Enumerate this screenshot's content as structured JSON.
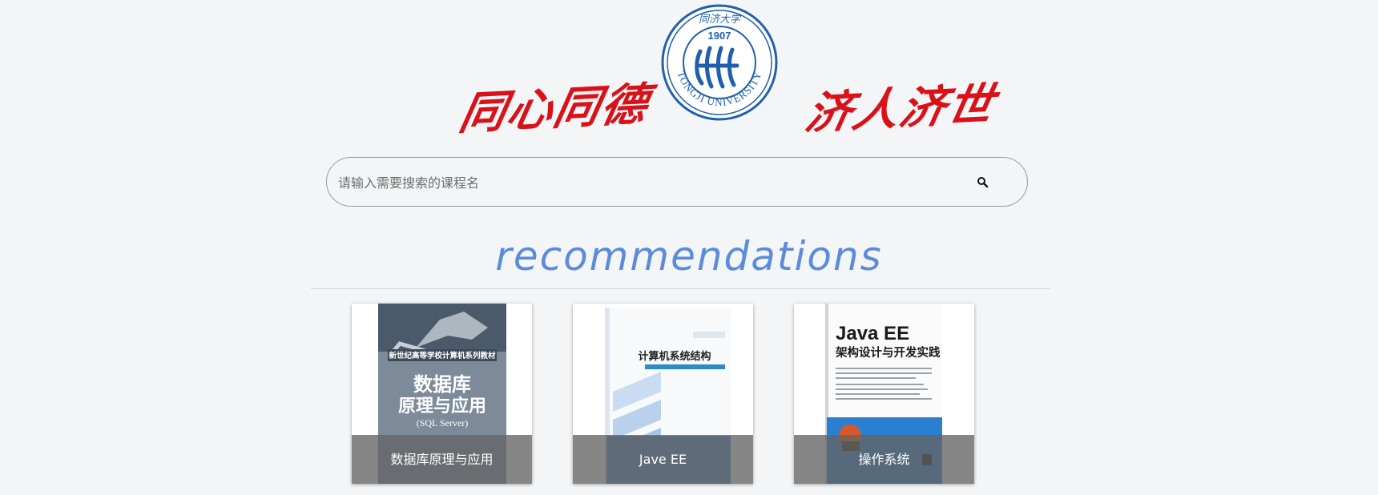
{
  "header": {
    "motto_left": "同心同德",
    "motto_right": "济人济世",
    "seal": {
      "year": "1907",
      "university": "TONGJI UNIVERSITY",
      "name_cn": "同济大学"
    }
  },
  "search": {
    "placeholder": "请输入需要搜索的课程名",
    "value": "",
    "button_icon": "search-icon"
  },
  "recommendations": {
    "title": "recommendations",
    "title_color": "#5b8cdc",
    "courses": [
      {
        "label": "数据库原理与应用",
        "cover": {
          "series": "新世纪高等学校计算机系列教材",
          "title_line1": "数据库",
          "title_line2": "原理与应用",
          "subtitle": "(SQL Server)"
        }
      },
      {
        "label": "Jave EE",
        "cover": {
          "title": "计算机系统结构"
        }
      },
      {
        "label": "操作系统",
        "cover": {
          "title_line1": "Java EE",
          "title_line2": "架构设计与开发实践"
        }
      }
    ]
  },
  "colors": {
    "background": "#f4f5f7",
    "motto": "#d9121a",
    "seal": "#1f5fae",
    "caption_overlay": "#646464"
  }
}
